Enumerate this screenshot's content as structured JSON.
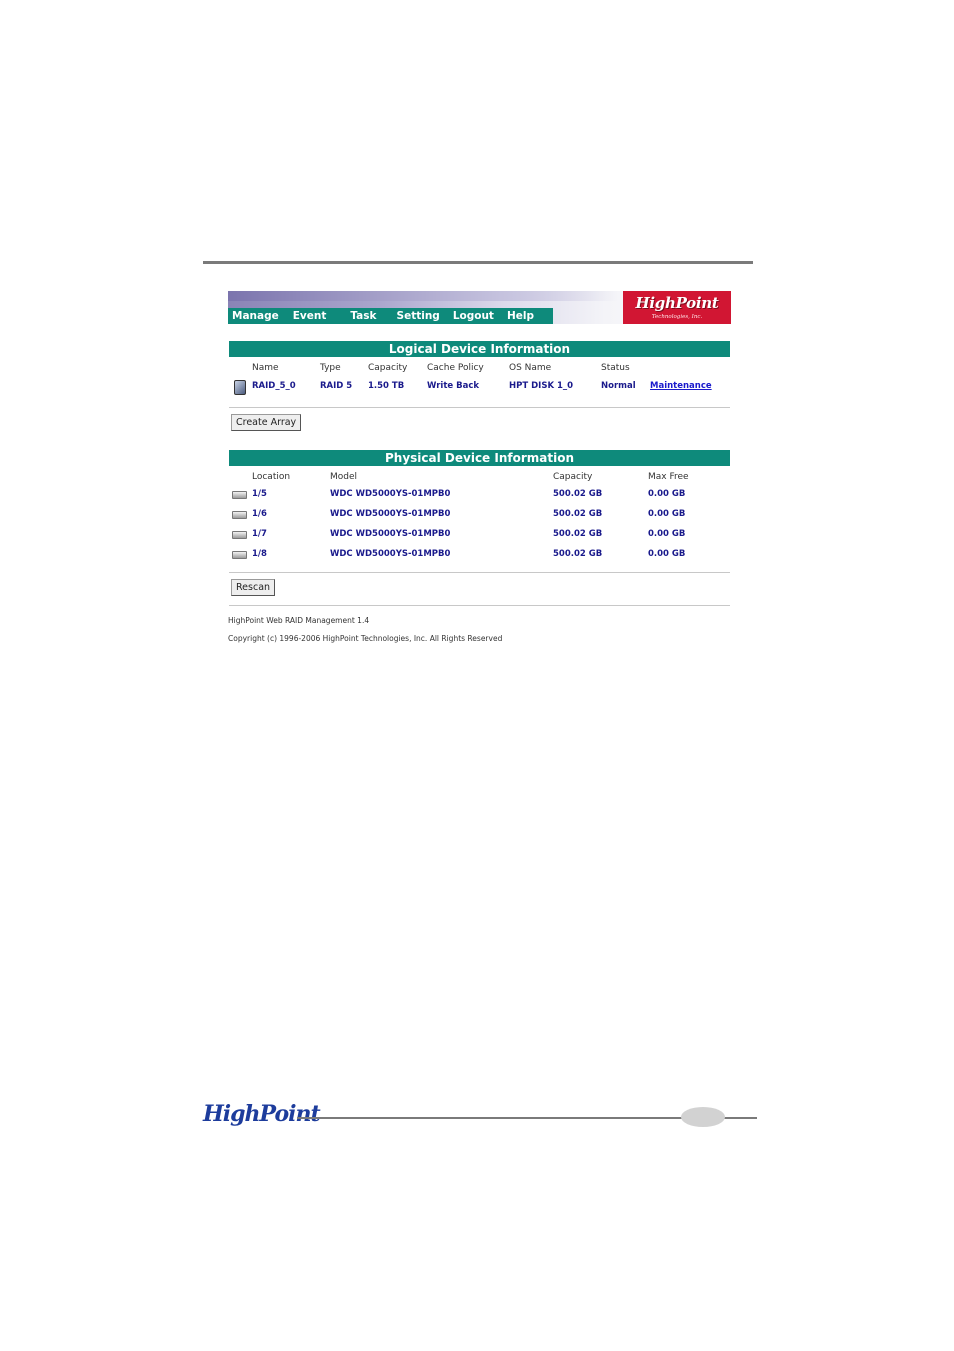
{
  "nav": [
    "Manage",
    "Event",
    "Task",
    "Setting",
    "Logout",
    "Help"
  ],
  "logo": {
    "name": "HighPoint",
    "tagline": "Technologies, Inc."
  },
  "logical": {
    "title": "Logical Device Information",
    "headers": [
      "Name",
      "Type",
      "Capacity",
      "Cache Policy",
      "OS Name",
      "Status"
    ],
    "row": {
      "name": "RAID_5_0",
      "type": "RAID 5",
      "capacity": "1.50 TB",
      "cache": "Write Back",
      "os_name": "HPT DISK 1_0",
      "status": "Normal",
      "action": "Maintenance"
    },
    "create_button": "Create Array"
  },
  "physical": {
    "title": "Physical Device Information",
    "headers": [
      "Location",
      "Model",
      "Capacity",
      "Max Free"
    ],
    "rows": [
      {
        "location": "1/5",
        "model": "WDC WD5000YS-01MPB0",
        "capacity": "500.02 GB",
        "max_free": "0.00 GB"
      },
      {
        "location": "1/6",
        "model": "WDC WD5000YS-01MPB0",
        "capacity": "500.02 GB",
        "max_free": "0.00 GB"
      },
      {
        "location": "1/7",
        "model": "WDC WD5000YS-01MPB0",
        "capacity": "500.02 GB",
        "max_free": "0.00 GB"
      },
      {
        "location": "1/8",
        "model": "WDC WD5000YS-01MPB0",
        "capacity": "500.02 GB",
        "max_free": "0.00 GB"
      }
    ],
    "rescan_button": "Rescan"
  },
  "footer": {
    "version": "HighPoint Web RAID Management 1.4",
    "copyright": "Copyright (c) 1996-2006 HighPoint Technologies, Inc. All Rights Reserved"
  },
  "page_logo": "HighPoint",
  "colors": {
    "accent": "#0e8a7b",
    "brand": "#d11633",
    "link": "#1a1a8c"
  }
}
